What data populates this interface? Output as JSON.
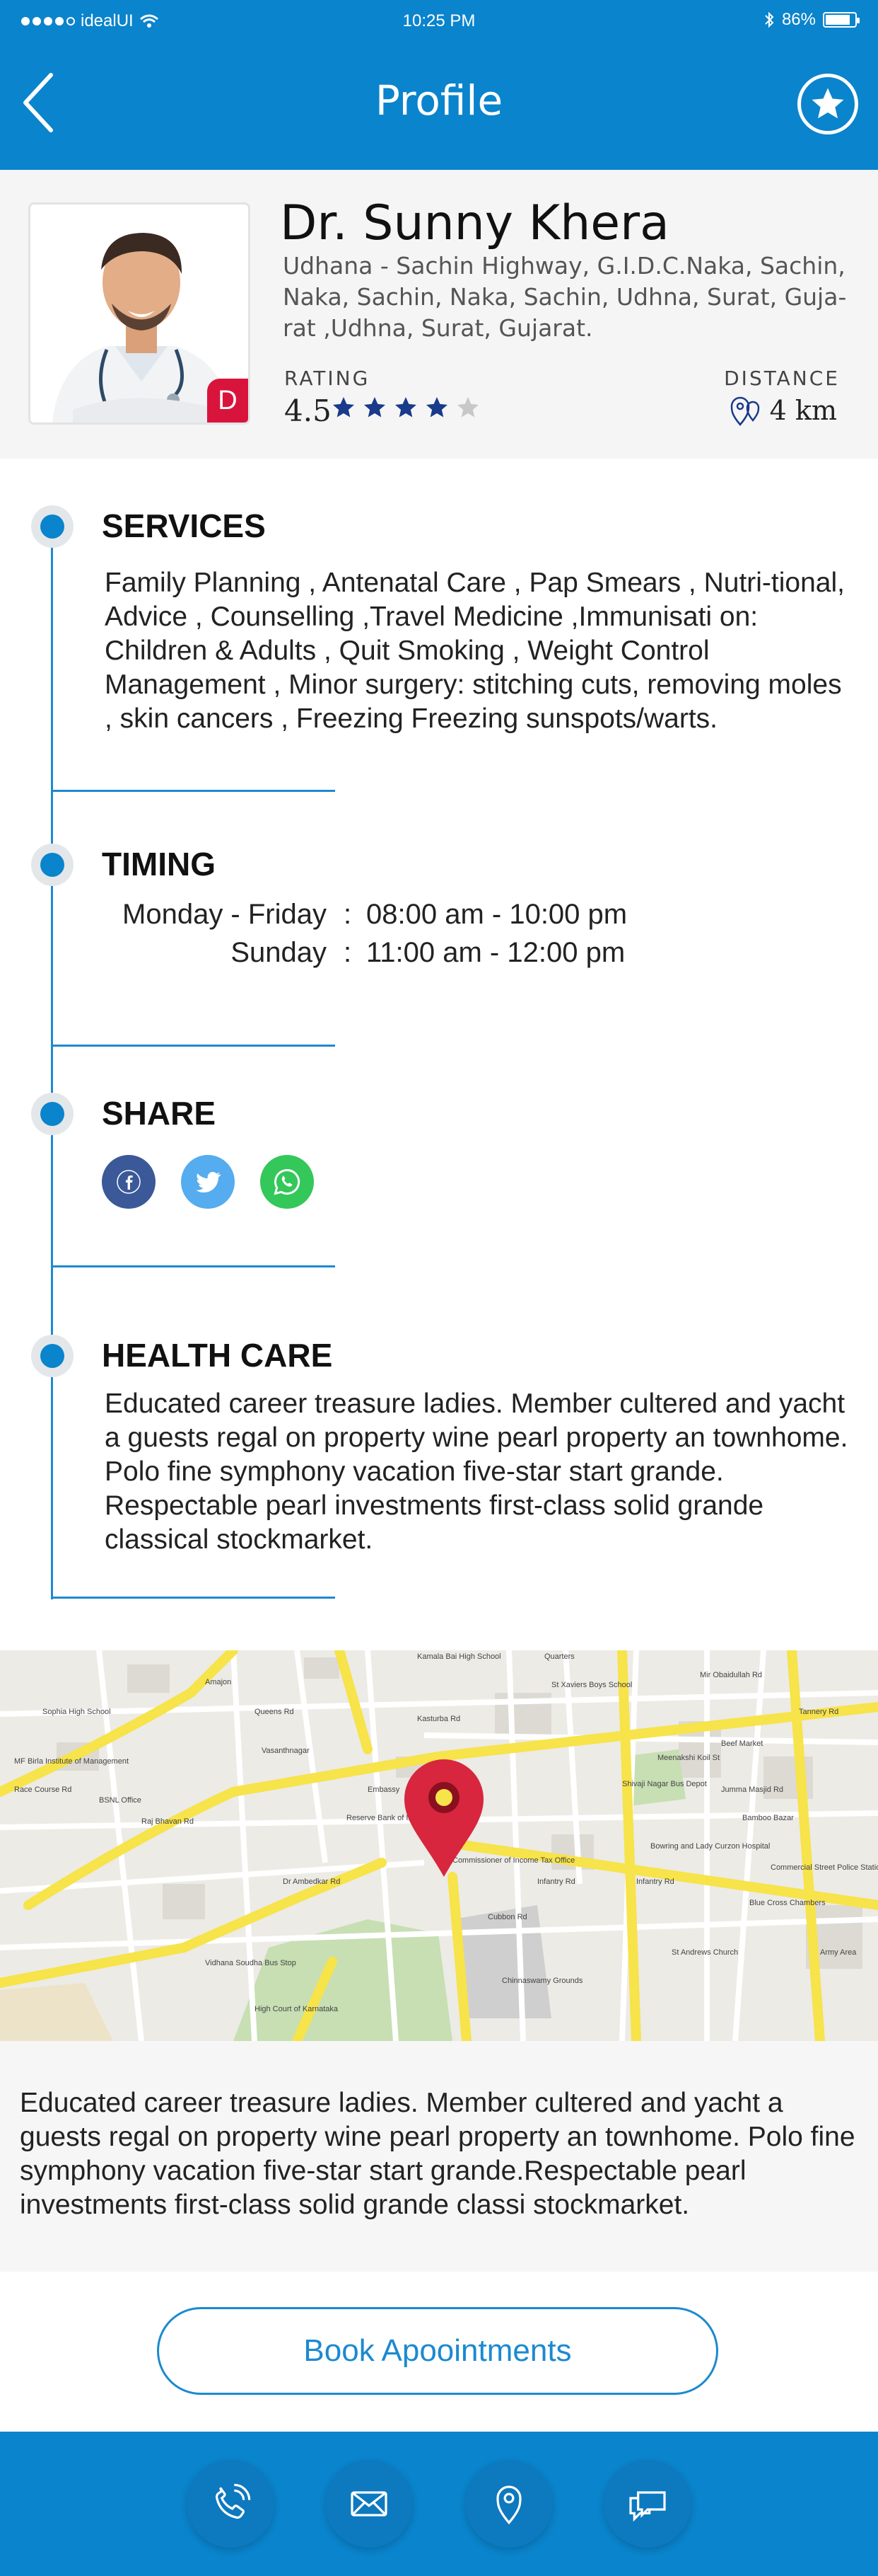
{
  "status_bar": {
    "carrier": "idealUI",
    "time": "10:25 PM",
    "battery": "86%",
    "battery_level": 0.86
  },
  "header": {
    "title": "Profile"
  },
  "doctor": {
    "name": "Dr. Sunny Khera",
    "address": "Udhana - Sachin Highway, G.I.D.C.Naka, Sachin, Naka, Sachin, Naka, Sachin, Udhna, Surat, Guja-rat ,Udhna, Surat, Gujarat.",
    "badge": "D",
    "rating_label": "RATING",
    "rating_value": "4.5",
    "stars_filled": 4,
    "stars_total": 5,
    "distance_label": "DISTANCE",
    "distance_value": "4 km"
  },
  "services": {
    "title": "SERVICES",
    "text": "Family Planning , Antenatal Care , Pap Smears , Nutri-tional, Advice , Counselling ,Travel Medicine ,Immunisati on: Children & Adults , Quit Smoking , Weight Control Management , Minor  surgery: stitching cuts, removing moles , skin cancers , Freezing  Freezing sunspots/warts."
  },
  "timing": {
    "title": "TIMING",
    "rows": [
      {
        "days": "Monday - Friday",
        "sep": ":",
        "hours": "08:00 am - 10:00 pm"
      },
      {
        "days": "Sunday",
        "sep": ":",
        "hours": "11:00 am - 12:00 pm"
      }
    ]
  },
  "share": {
    "title": "SHARE",
    "facebook_color": "#3b5998",
    "twitter_color": "#55acee",
    "whatsapp_color": "#34c759"
  },
  "health_care": {
    "title": "HEALTH CARE",
    "text": "Educated career treasure ladies. Member cultered  and yacht a guests regal on property wine pearl property an townhome.  Polo fine symphony vacation five-star  start grande. Respectable pearl investments first-class solid grande classical stockmarket."
  },
  "map": {
    "labels": {
      "l1": "Kamala Bai High School",
      "l2": "Quarters",
      "l3": "Mir Obaidullah Rd",
      "l4": "St Xaviers Boys School",
      "l5": "Sophia High School",
      "l6": "Amajon",
      "l7": "MF Birla Institute of Management",
      "l8": "Vasanthnagar",
      "l9": "BSNL Office",
      "l10": "Embassy",
      "l11": "Reserve Bank of India",
      "l12": "Commissioner of Income Tax Office",
      "l13": "Infantry Rd",
      "l14": "Shivaji Nagar Bus Depot",
      "l15": "Meenakshi Koil St",
      "l16": "Beef Market",
      "l17": "Cubbon Rd",
      "l18": "Chinnaswamy Grounds",
      "l19": "Vidhana Soudha Bus Stop",
      "l20": "High Court of Karnataka",
      "l21": "Race Course Rd",
      "l22": "Raj Bhavan Rd",
      "l23": "St Andrews Church",
      "l24": "Infantry Rd",
      "l25": "Blue Cross Chambers",
      "l26": "Commercial Street Police Station",
      "l27": "Bowring and Lady Curzon Hospital",
      "l28": "Army Area",
      "l29": "Tannery Rd",
      "l30": "Dr Ambedkar Rd",
      "l31": "Queens Rd",
      "l32": "Kasturba Rd",
      "l33": "Jumma Masjid Rd",
      "l34": "Bamboo Bazar"
    },
    "pin_color": "#d7263d"
  },
  "map_description": "Educated career treasure ladies. Member cultered  and yacht a guests regal on property wine pearl property an townhome. Polo fine symphony vacation five-star  start grande.Respectable pearl investments first-class solid   grande classi stockmarket.",
  "book_button": "Book Apoointments",
  "colors": {
    "primary": "#0a84cc",
    "accent_red": "#d9143c",
    "star": "#1a3a8a",
    "star_empty": "#c8c8c8"
  }
}
